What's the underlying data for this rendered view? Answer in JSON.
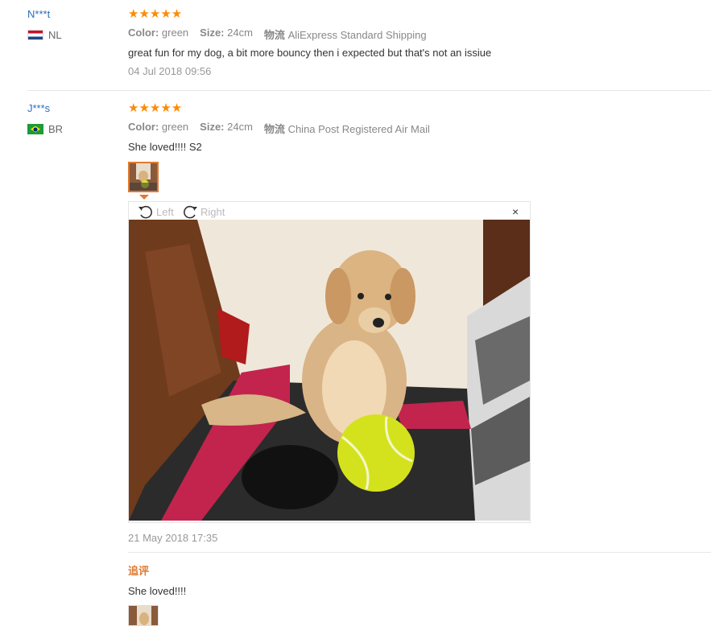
{
  "reviews": [
    {
      "user": "N***t",
      "country": "NL",
      "stars": "★★★★★",
      "meta": {
        "color_label": "Color:",
        "color_value": "green",
        "size_label": "Size:",
        "size_value": "24cm",
        "shipping_label": "物流",
        "shipping_value": "AliExpress Standard Shipping"
      },
      "content": "great fun for my dog, a bit more bouncy then i expected but that's not an issiue",
      "date": "04 Jul 2018 09:56"
    },
    {
      "user": "J***s",
      "country": "BR",
      "stars": "★★★★★",
      "meta": {
        "color_label": "Color:",
        "color_value": "green",
        "size_label": "Size:",
        "size_value": "24cm",
        "shipping_label": "物流",
        "shipping_value": "China Post Registered Air Mail"
      },
      "content": "She loved!!!! S2",
      "viewer": {
        "rotate_left": "Left",
        "rotate_right": "Right",
        "close": "×"
      },
      "date": "21 May 2018 17:35",
      "additional": {
        "label": "追评",
        "content": "She loved!!!!"
      }
    }
  ],
  "colors": {
    "star": "#ff8a00",
    "accent": "#e07a2f",
    "username": "#2a6fbd"
  }
}
